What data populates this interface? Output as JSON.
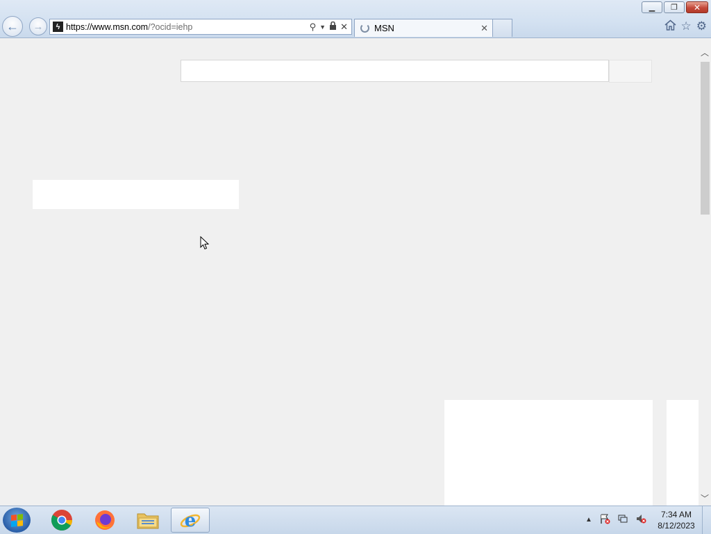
{
  "browser": {
    "url_main": "https://www.msn.com",
    "url_dim": "/?ocid=iehp",
    "tab_title": "MSN",
    "window_buttons": [
      "minimize",
      "restore",
      "close"
    ],
    "nav_icons": [
      "back-arrow-icon",
      "forward-arrow-icon"
    ],
    "command_icons": [
      "home-icon",
      "favorites-star-icon",
      "tools-gear-icon"
    ]
  },
  "taskbar": {
    "apps": [
      "Chrome",
      "Firefox",
      "Windows Explorer",
      "Internet Explorer"
    ],
    "active_app": "Internet Explorer",
    "clock_time": "7:34 AM",
    "clock_date": "8/12/2023"
  },
  "colors": {
    "chrome_bg": "#d3e1f1",
    "page_bg": "#f0f0f0",
    "close_red": "#c4493a"
  }
}
